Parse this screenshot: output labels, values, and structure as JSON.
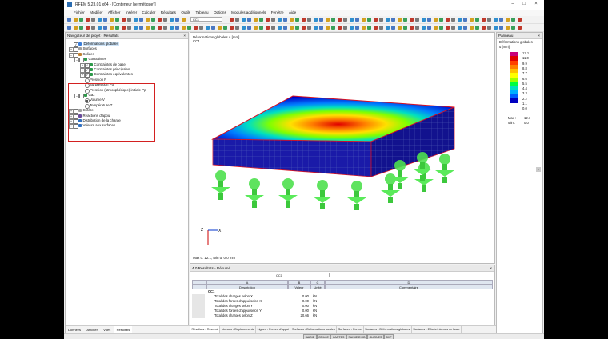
{
  "window": {
    "title": "RFEM 5.23.01 x64 - [Conteneur hermétique*]"
  },
  "menu": [
    "Fichier",
    "Modifier",
    "Afficher",
    "Insérer",
    "Calculer",
    "Résultats",
    "Outils",
    "Tableau",
    "Options",
    "Modules additionnels",
    "Fenêtre",
    "Aide"
  ],
  "toolbar": {
    "lc_combo": "CC1"
  },
  "navigator": {
    "title": "Navigateur de projet - Résultats",
    "items": [
      {
        "label": "Déformations globales",
        "selected": true
      },
      {
        "label": "Surfaces"
      },
      {
        "label": "Solides"
      },
      {
        "label": "Contraintes"
      },
      {
        "label": "Contraintes de base"
      },
      {
        "label": "Contraintes principales"
      },
      {
        "label": "Contraintes équivalentes"
      },
      {
        "label": "Pression P"
      },
      {
        "label": "Surpression Po"
      },
      {
        "label": "Pression (atmosphérique) initiale Pp"
      },
      {
        "label": "Gaz"
      },
      {
        "label": "Volume V"
      },
      {
        "label": "Température T"
      },
      {
        "label": "Critère"
      },
      {
        "label": "Réactions d'appui"
      },
      {
        "label": "Distribution de la charge"
      },
      {
        "label": "Valeurs aux surfaces"
      }
    ],
    "tabs": [
      "Données",
      "Afficher",
      "Vues",
      "Résultats"
    ]
  },
  "view": {
    "caption_line1": "Déformations globales u [mm]",
    "caption_line2": "CC1",
    "footer": "Max u: 12.1, Min u: 0.0 mm",
    "axis_z": "Z",
    "axis_x": "X"
  },
  "panel": {
    "title": "Panneau",
    "subtitle": "Déformations globales",
    "unit": "u [mm]",
    "levels": [
      "12.1",
      "11.0",
      "9.9",
      "8.8",
      "7.7",
      "6.6",
      "5.5",
      "4.4",
      "3.3",
      "2.2",
      "1.1",
      "0.0"
    ],
    "colors": [
      "#c8007a",
      "#e00000",
      "#ff4000",
      "#ff8000",
      "#ffc000",
      "#ffff00",
      "#a0ff00",
      "#00ff40",
      "#00e0c0",
      "#00b0ff",
      "#0060ff",
      "#0000c0"
    ],
    "max_label": "Max :",
    "max_val": "12.1",
    "min_label": "Min :",
    "min_val": "0.0"
  },
  "results": {
    "title": "4.0 Résultats - Résumé",
    "combo": "CC1",
    "col_letters": [
      "A",
      "B",
      "C",
      "D"
    ],
    "col_headers": [
      "Description",
      "Valeur",
      "Unité",
      "Commentaire"
    ],
    "group": "CC1",
    "rows": [
      {
        "desc": "Total des charges selon X",
        "val": "0.00",
        "unit": "kN"
      },
      {
        "desc": "Total des forces d'appui selon X",
        "val": "0.00",
        "unit": "kN"
      },
      {
        "desc": "Total des charges selon Y",
        "val": "0.00",
        "unit": "kN"
      },
      {
        "desc": "Total des forces d'appui selon Y",
        "val": "0.00",
        "unit": "kN"
      },
      {
        "desc": "Total des charges selon Z",
        "val": "20.66",
        "unit": "kN"
      }
    ],
    "tabs": [
      "Résultats - Résumé",
      "Noeuds - Déplacements",
      "Lignes - Forces d'appui",
      "Surfaces - Déformations locales",
      "Surfaces - Forme",
      "Surfaces - Déformations globales",
      "Surfaces - Efforts internes de base"
    ]
  },
  "status": [
    "SAISIE",
    "GRILLE",
    "CARTES",
    "SAISIE D'OB",
    "GLIGNES",
    "DXF"
  ]
}
